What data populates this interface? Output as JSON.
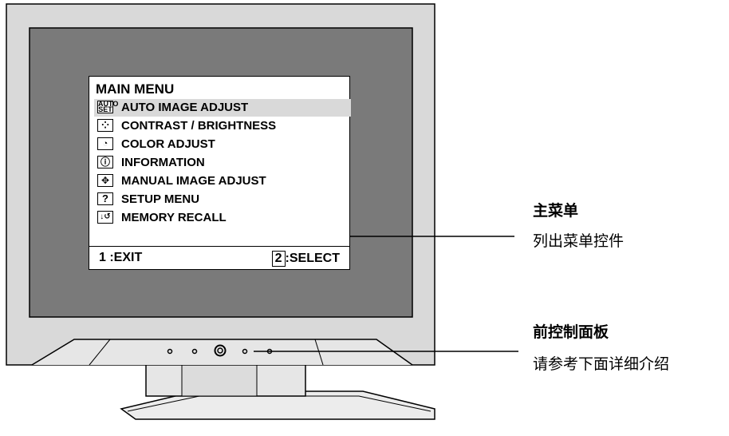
{
  "osd": {
    "title": "MAIN MENU",
    "items": [
      {
        "label": "AUTO IMAGE ADJUST",
        "icon": "auto-set-icon",
        "icon_text": [
          "AUTO",
          "SET"
        ],
        "selected": true
      },
      {
        "label": "CONTRAST / BRIGHTNESS",
        "icon": "contrast-icon",
        "icon_text": [
          "⁘"
        ]
      },
      {
        "label": "COLOR ADJUST",
        "icon": "color-icon",
        "icon_text": [
          "◔"
        ]
      },
      {
        "label": "INFORMATION",
        "icon": "info-icon",
        "icon_text": [
          "ⓘ"
        ]
      },
      {
        "label": "MANUAL IMAGE ADJUST",
        "icon": "move-icon",
        "icon_text": [
          "✥"
        ]
      },
      {
        "label": "SETUP MENU",
        "icon": "question-icon",
        "icon_text": [
          "?"
        ]
      },
      {
        "label": "MEMORY RECALL",
        "icon": "recall-icon",
        "icon_text": [
          "↓↺"
        ]
      }
    ],
    "exit_label": "1 :EXIT",
    "select_key": "2",
    "select_label": ":SELECT"
  },
  "callouts": {
    "main_menu_title": "主菜单",
    "main_menu_desc": "列出菜单控件",
    "front_panel_title": "前控制面板",
    "front_panel_desc": "请参考下面详细介绍"
  }
}
